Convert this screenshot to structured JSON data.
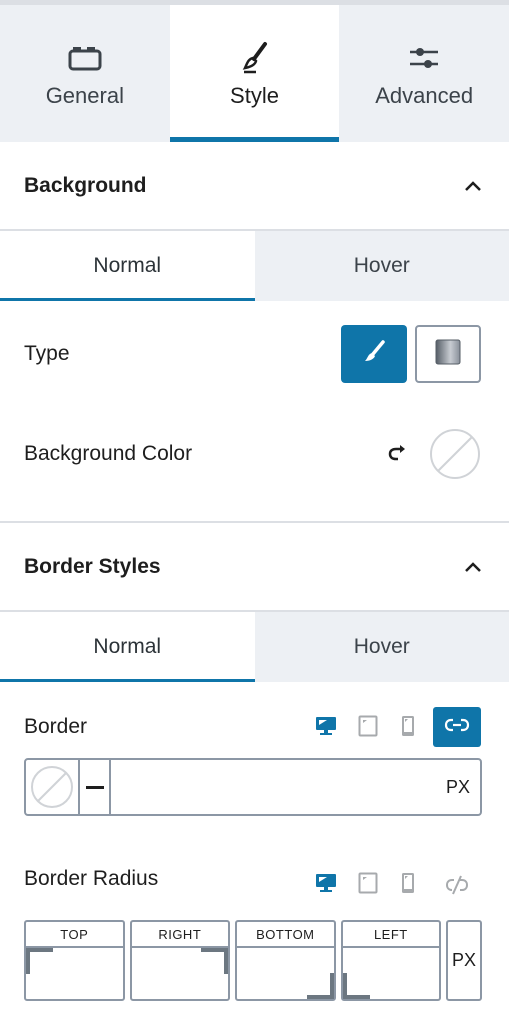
{
  "main_tabs": [
    {
      "label": "General",
      "icon": "block-icon",
      "active": false
    },
    {
      "label": "Style",
      "icon": "brush-icon",
      "active": true
    },
    {
      "label": "Advanced",
      "icon": "sliders-icon",
      "active": false
    }
  ],
  "background": {
    "title": "Background",
    "expanded": true,
    "state_tabs": [
      {
        "label": "Normal",
        "active": true
      },
      {
        "label": "Hover",
        "active": false
      }
    ],
    "type_label": "Type",
    "type_options": [
      {
        "name": "classic",
        "icon": "paint-brush-icon",
        "active": true
      },
      {
        "name": "gradient",
        "icon": "gradient-icon",
        "active": false
      }
    ],
    "color_label": "Background Color",
    "color_value": "none"
  },
  "border_styles": {
    "title": "Border Styles",
    "expanded": true,
    "state_tabs": [
      {
        "label": "Normal",
        "active": true
      },
      {
        "label": "Hover",
        "active": false
      }
    ],
    "border": {
      "label": "Border",
      "devices": [
        "desktop",
        "tablet",
        "mobile"
      ],
      "active_device": "desktop",
      "linked": true,
      "color": "none",
      "style": "solid",
      "width_value": "",
      "unit": "PX"
    },
    "border_radius": {
      "label": "Border Radius",
      "devices": [
        "desktop",
        "tablet",
        "mobile"
      ],
      "active_device": "desktop",
      "linked": false,
      "fields": [
        {
          "label": "TOP",
          "value": ""
        },
        {
          "label": "RIGHT",
          "value": ""
        },
        {
          "label": "BOTTOM",
          "value": ""
        },
        {
          "label": "LEFT",
          "value": ""
        }
      ],
      "unit": "PX"
    }
  },
  "colors": {
    "accent": "#0f75a9",
    "tab_bg": "#edf0f4",
    "border": "#8c97a5"
  }
}
